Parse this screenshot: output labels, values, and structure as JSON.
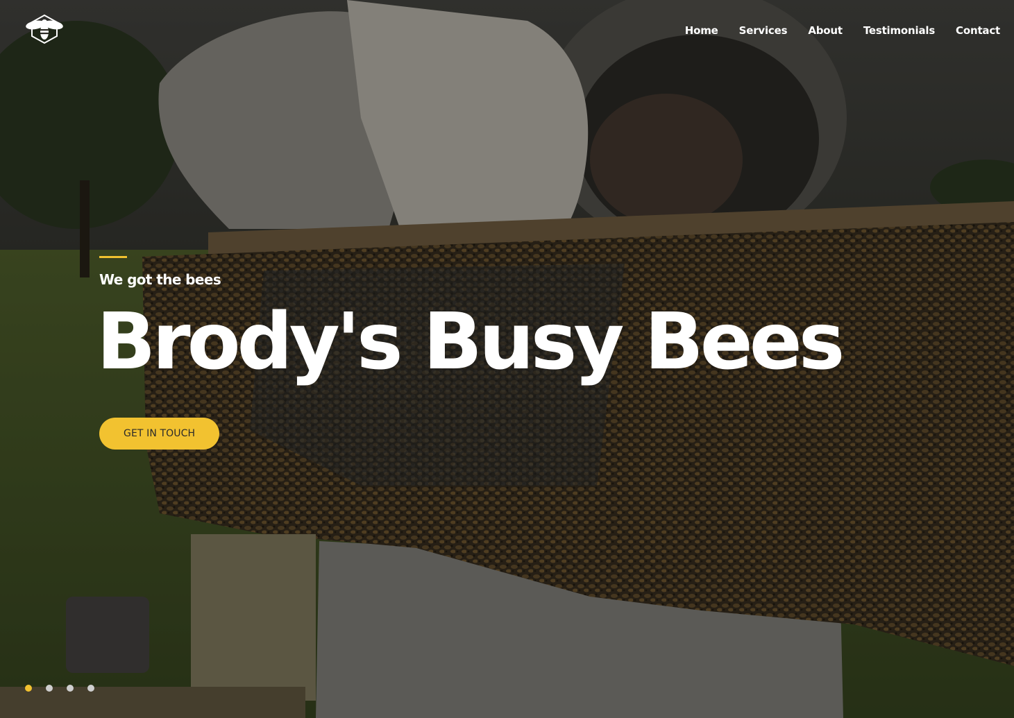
{
  "header": {
    "logo_icon": "bee-logo-icon",
    "nav": [
      {
        "label": "Home"
      },
      {
        "label": "Services"
      },
      {
        "label": "About"
      },
      {
        "label": "Testimonials"
      },
      {
        "label": "Contact"
      }
    ]
  },
  "hero": {
    "tagline": "We got the bees",
    "title": "Brody's Busy Bees",
    "cta_label": "GET IN TOUCH",
    "slides": {
      "count": 4,
      "active_index": 0
    }
  },
  "colors": {
    "accent": "#f2c230",
    "text": "#ffffff",
    "dot_inactive": "#cfcfcf"
  }
}
